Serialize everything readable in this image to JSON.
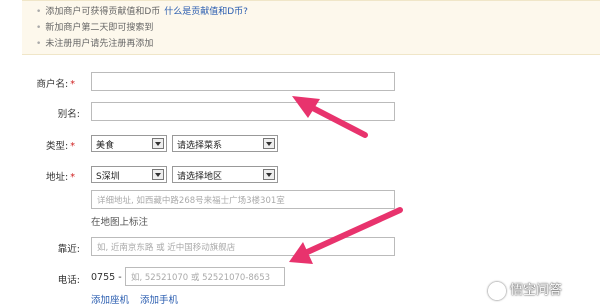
{
  "notice": {
    "item1": "添加商户可获得贡献值和D币",
    "item1_link": "什么是贡献值和D币?",
    "item2": "新加商户第二天即可搜索到",
    "item3": "未注册用户请先注册再添加"
  },
  "form": {
    "merchant_name_label": "商户名:",
    "alias_label": "别名:",
    "type_label": "类型:",
    "address_label": "地址:",
    "nearby_label": "靠近:",
    "phone_label": "电话:",
    "required_mark": "*",
    "type_select": "美食",
    "cuisine_select": "请选择菜系",
    "city_select": "S深圳",
    "district_select": "请选择地区",
    "address_placeholder": "详细地址, 如西藏中路268号来福士广场3楼301室",
    "map_link": "在地图上标注",
    "nearby_placeholder": "如, 近南京东路 或 近中国移动旗舰店",
    "area_code": "0755 -",
    "phone_placeholder": "如, 52521070 或 52521070-8653",
    "add_landline": "添加座机",
    "add_mobile": "添加手机"
  },
  "watermark": {
    "text": "悟空问答",
    "icon": "wukong-logo-icon"
  },
  "colors": {
    "annotation_arrow": "#e8336d",
    "link": "#2a5db0",
    "required": "#d02020",
    "notice_bg": "#fdf8ec"
  }
}
